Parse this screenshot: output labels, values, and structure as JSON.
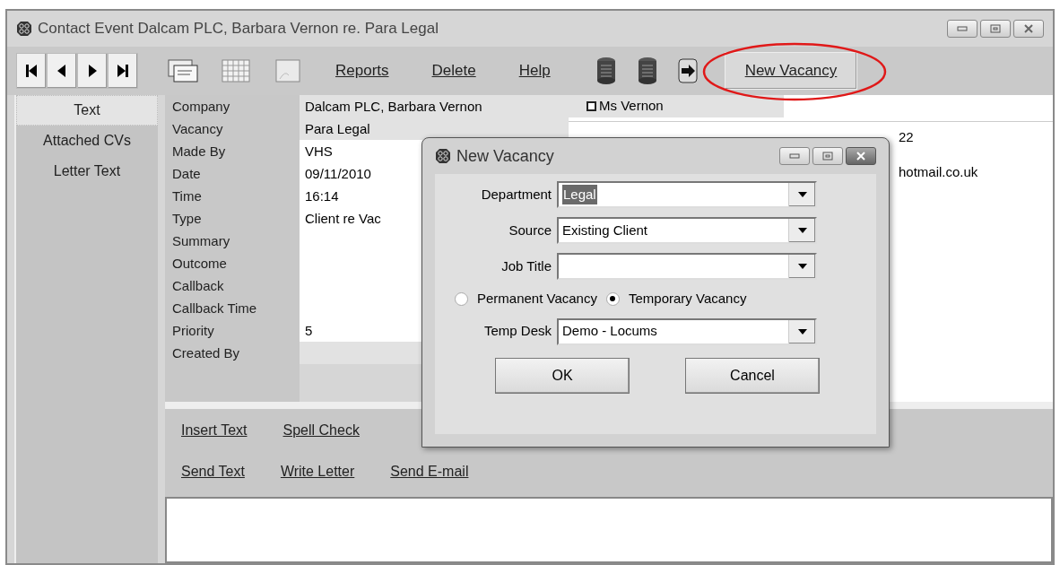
{
  "window": {
    "title": "Contact Event Dalcam PLC, Barbara Vernon re. Para Legal"
  },
  "toolbar": {
    "links": [
      "Reports",
      "Delete",
      "Help"
    ],
    "action_button": {
      "label": "New Vacancy",
      "circled": true
    }
  },
  "tabs": [
    {
      "label": "Text",
      "selected": true
    },
    {
      "label": "Attached CVs",
      "selected": false
    },
    {
      "label": "Letter Text",
      "selected": false
    }
  ],
  "fields": [
    {
      "label": "Company",
      "value": "Dalcam PLC, Barbara Vernon"
    },
    {
      "label": "Vacancy",
      "value": "Para Legal"
    },
    {
      "label": "Made By",
      "value": "VHS"
    },
    {
      "label": "Date",
      "value": "09/11/2010"
    },
    {
      "label": "Time",
      "value": "16:14"
    },
    {
      "label": "Type",
      "value": "Client re Vac"
    },
    {
      "label": "Summary"
    },
    {
      "label": "Outcome"
    },
    {
      "label": "Callback"
    },
    {
      "label": "Callback Time"
    },
    {
      "label": "Priority",
      "value": "5"
    },
    {
      "label": "Created By"
    }
  ],
  "contact": {
    "name": "Ms Vernon",
    "checked": false,
    "lines": [
      "22",
      "hotmail.co.uk"
    ]
  },
  "actions": [
    [
      "Insert Text",
      "Spell Check"
    ],
    [
      "Send Text",
      "Write Letter",
      "Send E-mail"
    ]
  ],
  "dialog": {
    "title": "New Vacancy",
    "fields": [
      {
        "label": "Department",
        "value": "Legal",
        "highlighted": true
      },
      {
        "label": "Source",
        "value": "Existing Client",
        "highlighted": false
      },
      {
        "label": "Job Title"
      }
    ],
    "radios": [
      {
        "label": "Permanent Vacancy",
        "selected": false
      },
      {
        "label": "Temporary Vacancy",
        "selected": true
      }
    ],
    "temp_desk": {
      "label": "Temp Desk",
      "value": "Demo - Locums"
    },
    "buttons": [
      "OK",
      "Cancel"
    ]
  }
}
